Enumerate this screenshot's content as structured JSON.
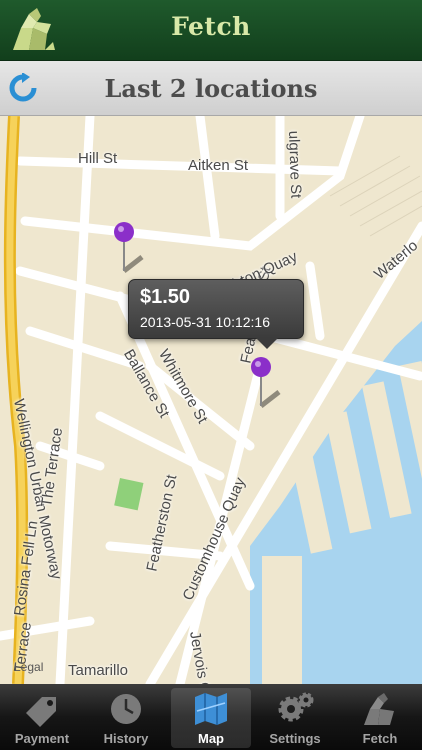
{
  "header": {
    "title": "Fetch",
    "logo_icon": "origami-dog-icon"
  },
  "subbar": {
    "title": "Last 2 locations",
    "refresh_icon": "refresh-icon"
  },
  "map": {
    "streets": [
      "Hill St",
      "Aitken St",
      "ulgrave St",
      "Waterlo",
      "Featherston St",
      "mbton Quay",
      "Ballance St",
      "Whitmore St",
      "Wellington Urban Motorway",
      "The Terrace",
      "Featherston St",
      "Customhouse Quay",
      "Rosina Fell Ln",
      "Terrace",
      "Jervois Q",
      "Tamarillo"
    ],
    "callout": {
      "amount": "$1.50",
      "timestamp": "2013-05-31 10:12:16"
    },
    "legal": "Legal",
    "pin_color": "#8b2fc9"
  },
  "tabs": [
    {
      "label": "Payment",
      "icon": "price-tag-icon"
    },
    {
      "label": "History",
      "icon": "clock-icon"
    },
    {
      "label": "Map",
      "icon": "map-icon"
    },
    {
      "label": "Settings",
      "icon": "gears-icon"
    },
    {
      "label": "Fetch",
      "icon": "origami-dog-icon"
    }
  ],
  "active_tab": "Map",
  "colors": {
    "header_bg": "#1f5a2c",
    "title": "#d8e8a8",
    "map_land": "#efe7cf",
    "water": "#a8d4ef",
    "motorway": "#f2c230"
  }
}
